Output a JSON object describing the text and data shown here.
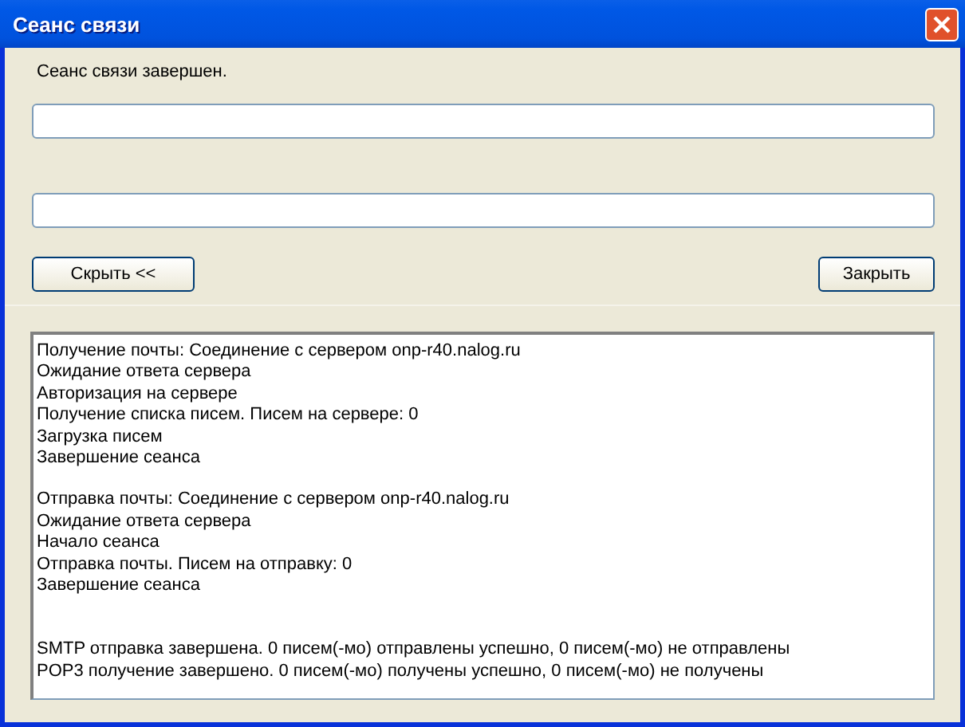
{
  "window": {
    "title": "Сеанс связи"
  },
  "status": "Сеанс связи завершен.",
  "fields": [
    {
      "kind": "text"
    },
    {
      "kind": "text"
    }
  ],
  "buttons": {
    "hide": "Скрыть <<",
    "close": "Закрыть"
  },
  "log": [
    [
      "Получение почты: Соединение с сервером onp-r40.nalog.ru",
      "Ожидание ответа сервера",
      "Авторизация на сервере",
      "Получение списка писем. Писем на сервере: 0",
      "Загрузка писем",
      "Завершение сеанса"
    ],
    [
      "Отправка почты: Соединение с сервером onp-r40.nalog.ru",
      "Ожидание ответа сервера",
      "Начало сеанса",
      "Отправка почты. Писем на отправку: 0",
      "Завершение сеанса"
    ],
    [
      "SMTP отправка завершена. 0 писем(-мо) отправлены успешно, 0 писем(-мо) не отправлены",
      "POP3 получение завершено. 0 писем(-мо) получены успешно, 0 писем(-мо) не получены"
    ]
  ]
}
